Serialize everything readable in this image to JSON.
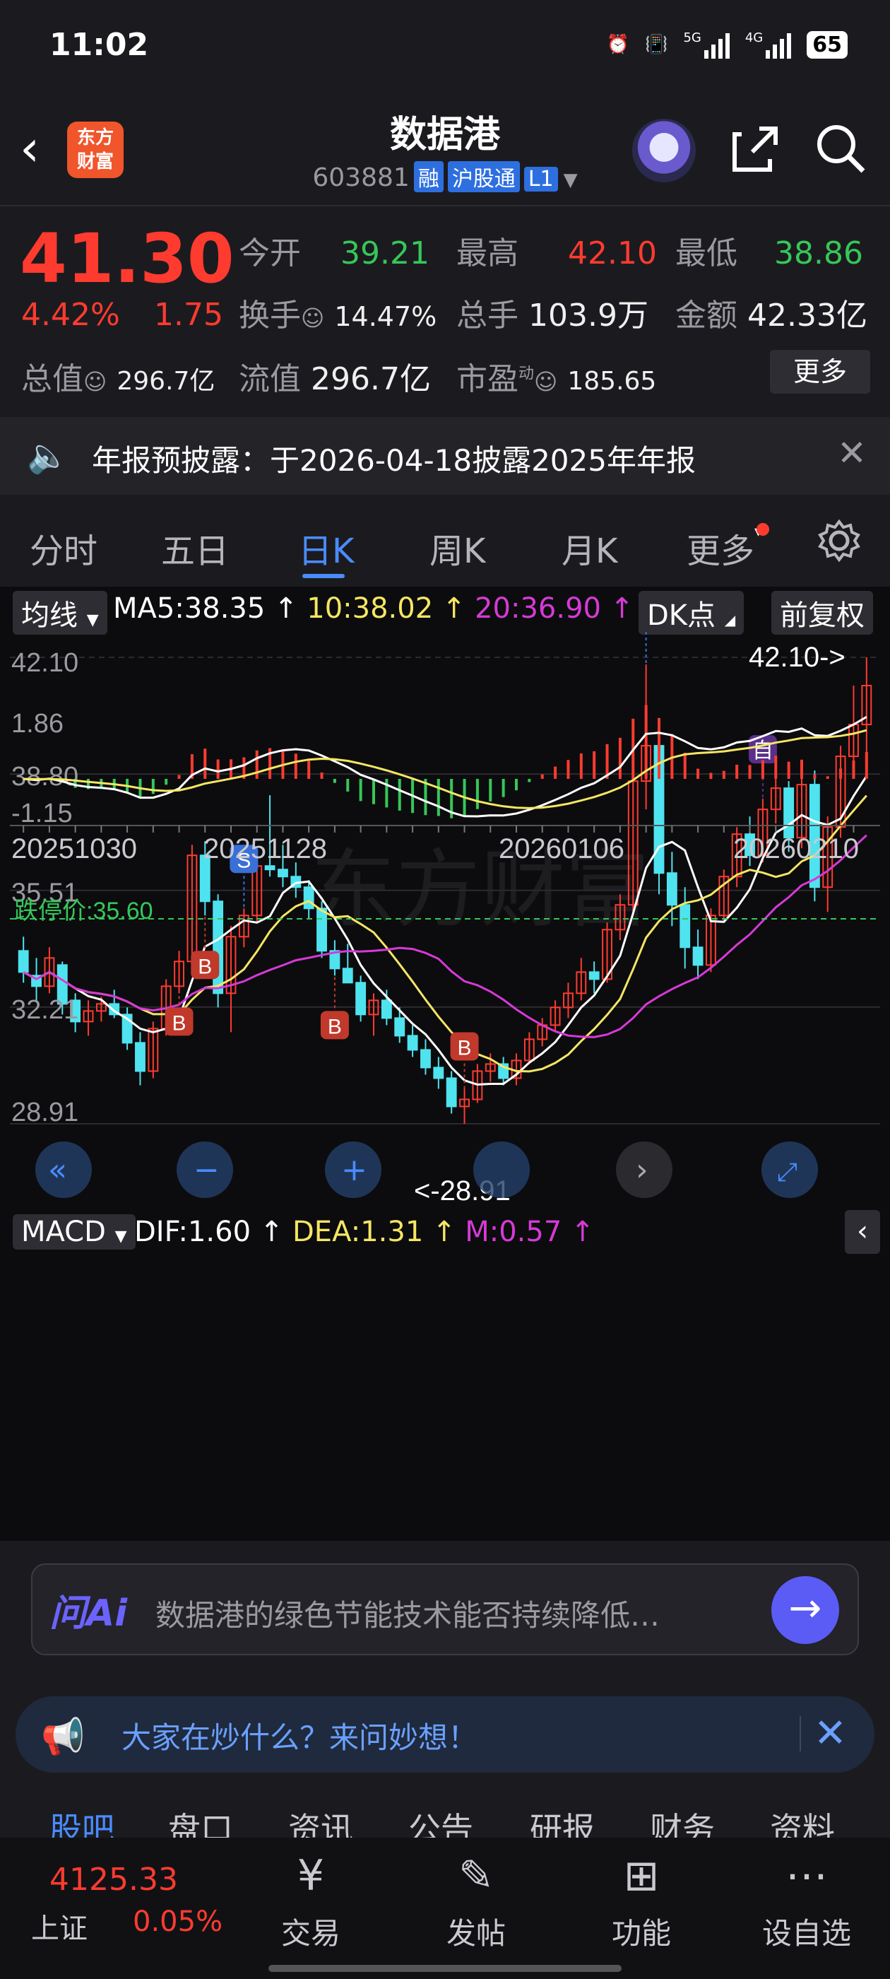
{
  "status_bar": {
    "time": "11:02",
    "network": "5G",
    "network2": "4G",
    "battery": "65"
  },
  "header": {
    "stock_name": "数据港",
    "code": "603881",
    "tags": [
      "融",
      "沪股通",
      "L1"
    ],
    "app_logo": "东方财富"
  },
  "quote": {
    "price": "41.30",
    "pct": "4.42%",
    "change": "1.75",
    "rows": [
      [
        {
          "label": "今开",
          "value": "39.21",
          "color": "green"
        },
        {
          "label": "最高",
          "value": "42.10",
          "color": "red"
        },
        {
          "label": "最低",
          "value": "38.86",
          "color": "green"
        }
      ],
      [
        {
          "label": "换手",
          "value": "14.47%",
          "color": "white"
        },
        {
          "label": "总手",
          "value": "103.9万",
          "color": "white"
        },
        {
          "label": "金额",
          "value": "42.33亿",
          "color": "white"
        }
      ],
      [
        {
          "label": "总值",
          "value": "296.7亿",
          "color": "white"
        },
        {
          "label": "流值",
          "value": "296.7亿",
          "color": "white"
        },
        {
          "label": "市盈",
          "value": "185.65",
          "color": "white"
        }
      ]
    ],
    "pe_superscript": "动",
    "more_label": "更多"
  },
  "notice": {
    "text": "年报预披露：于2026-04-18披露2025年年报"
  },
  "tabs": [
    "分时",
    "五日",
    "日K",
    "周K",
    "月K",
    "更多"
  ],
  "active_tab": "日K",
  "kline": {
    "ma_label": "均线",
    "ma5": "MA5:38.35",
    "ma10": "10:38.02",
    "ma20": "20:36.90",
    "dk_label": "DK点",
    "adjust_label": "前复权",
    "limit_down_label": "跌停价:35.60",
    "high_marker": "42.10->",
    "low_marker": "<-28.91",
    "watermark": "东方财富",
    "colors": {
      "ma5": "#ffffff",
      "ma10": "#f5e663",
      "ma20": "#d63ad6",
      "up": "#ff3b30",
      "down": "#4fe3f0"
    }
  },
  "macd": {
    "label": "MACD",
    "dif": "DIF:1.60",
    "dea": "DEA:1.31",
    "m": "M:0.57"
  },
  "chart_data": [
    {
      "type": "candlestick",
      "title": "日K",
      "ylim": [
        28.91,
        42.1
      ],
      "y_ticks": [
        "42.10",
        "38.80",
        "35.51",
        "32.21",
        "28.91"
      ],
      "x_ticks": [
        "20251030",
        "20251128",
        "20260106",
        "20260210"
      ],
      "series": [
        {
          "name": "MA5",
          "last": 38.35
        },
        {
          "name": "MA10",
          "last": 38.02
        },
        {
          "name": "MA20",
          "last": 36.9
        }
      ],
      "candles": [
        [
          33.8,
          34.2,
          32.9,
          33.2
        ],
        [
          33.1,
          33.6,
          32.4,
          32.8
        ],
        [
          32.8,
          33.9,
          32.6,
          33.6
        ],
        [
          33.4,
          33.5,
          32.0,
          32.3
        ],
        [
          32.4,
          32.6,
          31.5,
          31.8
        ],
        [
          31.8,
          32.4,
          31.4,
          32.1
        ],
        [
          32.1,
          32.5,
          31.8,
          32.3
        ],
        [
          32.3,
          32.7,
          31.9,
          32.0
        ],
        [
          32.0,
          32.2,
          31.0,
          31.2
        ],
        [
          31.2,
          31.5,
          30.0,
          30.4
        ],
        [
          30.4,
          31.8,
          30.2,
          31.6
        ],
        [
          31.6,
          33.0,
          31.4,
          32.8
        ],
        [
          32.8,
          33.8,
          32.6,
          33.5
        ],
        [
          33.5,
          36.8,
          33.3,
          36.5
        ],
        [
          36.5,
          36.9,
          34.8,
          35.2
        ],
        [
          35.2,
          35.4,
          32.2,
          32.6
        ],
        [
          32.6,
          34.5,
          31.5,
          34.2
        ],
        [
          34.2,
          35.0,
          33.9,
          34.8
        ],
        [
          34.8,
          36.6,
          34.6,
          36.2
        ],
        [
          36.2,
          38.2,
          35.9,
          36.1
        ],
        [
          36.1,
          36.8,
          35.6,
          35.9
        ],
        [
          35.9,
          36.3,
          35.3,
          35.6
        ],
        [
          35.6,
          35.8,
          34.7,
          35.0
        ],
        [
          35.0,
          35.2,
          33.6,
          33.8
        ],
        [
          33.8,
          34.1,
          33.1,
          33.3
        ],
        [
          33.3,
          34.0,
          32.9,
          32.9
        ],
        [
          32.9,
          33.1,
          31.8,
          32.0
        ],
        [
          32.0,
          32.6,
          31.4,
          32.4
        ],
        [
          32.4,
          32.7,
          31.7,
          31.9
        ],
        [
          31.9,
          32.2,
          31.2,
          31.4
        ],
        [
          31.4,
          31.7,
          30.8,
          31.0
        ],
        [
          31.0,
          31.3,
          30.3,
          30.5
        ],
        [
          30.5,
          30.8,
          29.9,
          30.2
        ],
        [
          30.2,
          30.4,
          29.2,
          29.4
        ],
        [
          29.4,
          29.9,
          28.91,
          29.6
        ],
        [
          29.6,
          30.6,
          29.5,
          30.4
        ],
        [
          30.4,
          30.9,
          30.1,
          30.6
        ],
        [
          30.6,
          30.8,
          30.0,
          30.2
        ],
        [
          30.2,
          30.9,
          30.0,
          30.7
        ],
        [
          30.7,
          31.5,
          30.6,
          31.3
        ],
        [
          31.3,
          31.9,
          31.1,
          31.7
        ],
        [
          31.7,
          32.4,
          31.5,
          32.2
        ],
        [
          32.2,
          32.9,
          31.9,
          32.6
        ],
        [
          32.6,
          33.6,
          32.4,
          33.2
        ],
        [
          33.2,
          33.5,
          32.6,
          33.0
        ],
        [
          33.0,
          34.6,
          32.9,
          34.4
        ],
        [
          34.4,
          35.4,
          34.1,
          35.1
        ],
        [
          35.1,
          38.9,
          34.9,
          38.6
        ],
        [
          38.6,
          41.9,
          37.8,
          39.6
        ],
        [
          39.6,
          40.3,
          35.4,
          36.0
        ],
        [
          36.0,
          36.6,
          34.5,
          35.1
        ],
        [
          35.1,
          35.6,
          33.3,
          33.9
        ],
        [
          33.9,
          34.4,
          33.0,
          33.4
        ],
        [
          33.4,
          35.0,
          33.2,
          34.8
        ],
        [
          34.8,
          36.1,
          34.6,
          35.9
        ],
        [
          35.9,
          37.3,
          35.6,
          37.1
        ],
        [
          37.1,
          37.6,
          36.2,
          36.5
        ],
        [
          36.5,
          38.1,
          36.3,
          37.8
        ],
        [
          37.8,
          39.2,
          37.4,
          38.4
        ],
        [
          38.4,
          38.6,
          36.6,
          37.0
        ],
        [
          37.0,
          38.9,
          36.7,
          38.5
        ],
        [
          38.5,
          38.9,
          35.2,
          35.6
        ],
        [
          35.6,
          37.6,
          34.9,
          37.3
        ],
        [
          37.3,
          39.6,
          37.0,
          39.3
        ],
        [
          39.3,
          41.3,
          38.9,
          40.2
        ],
        [
          40.2,
          42.1,
          38.86,
          41.3
        ]
      ]
    },
    {
      "type": "bar",
      "title": "MACD",
      "ylim": [
        -1.15,
        1.86
      ],
      "y_ticks": [
        "1.86",
        "-1.15"
      ],
      "series": [
        {
          "name": "DIF",
          "last": 1.6
        },
        {
          "name": "DEA",
          "last": 1.31
        },
        {
          "name": "M",
          "last": 0.57
        }
      ]
    }
  ],
  "ask": {
    "logo": "问Ai",
    "text": "数据港的绿色节能技术能否持续降低…"
  },
  "discuss": {
    "text": "大家在炒什么？来问妙想！"
  },
  "sections": [
    "股吧",
    "盘口",
    "资讯",
    "公告",
    "研报",
    "财务",
    "资料"
  ],
  "bottom_nav": {
    "index_value": "4125.33",
    "index_name": "上证",
    "index_pct": "0.05%",
    "items": [
      "交易",
      "发帖",
      "功能",
      "设自选"
    ]
  }
}
